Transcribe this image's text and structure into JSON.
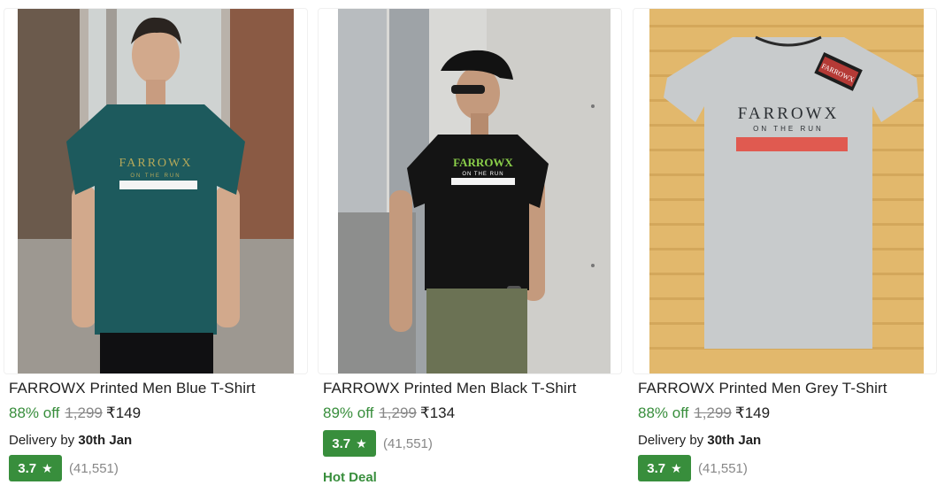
{
  "products": [
    {
      "title": "FARROWX Printed Men Blue T-Shirt",
      "discount": "88% off",
      "mrp": "1,299",
      "price": "₹149",
      "delivery_prefix": "Delivery by",
      "delivery_date": "30th Jan",
      "rating": "3.7",
      "rating_count": "(41,551)",
      "tshirt_color": "#1d5a5d",
      "print_text": "FARROWX",
      "print_sub": "ON THE RUN"
    },
    {
      "title": "FARROWX Printed Men Black T-Shirt",
      "discount": "89% off",
      "mrp": "1,299",
      "price": "₹134",
      "rating": "3.7",
      "rating_count": "(41,551)",
      "tag": "Hot Deal",
      "tshirt_color": "#141414",
      "print_text": "FARROWX",
      "print_sub": "ON THE RUN"
    },
    {
      "title": "FARROWX Printed Men Grey T-Shirt",
      "discount": "88% off",
      "mrp": "1,299",
      "price": "₹149",
      "delivery_prefix": "Delivery by",
      "delivery_date": "30th Jan",
      "rating": "3.7",
      "rating_count": "(41,551)",
      "tshirt_color": "#c8cbcc",
      "print_text": "FARROWX",
      "print_sub": "ON THE RUN",
      "tag_text": "FARROWX"
    }
  ],
  "colors": {
    "green": "#388e3c",
    "muted": "#878787",
    "text": "#212121"
  },
  "icons": [
    "star-icon"
  ]
}
